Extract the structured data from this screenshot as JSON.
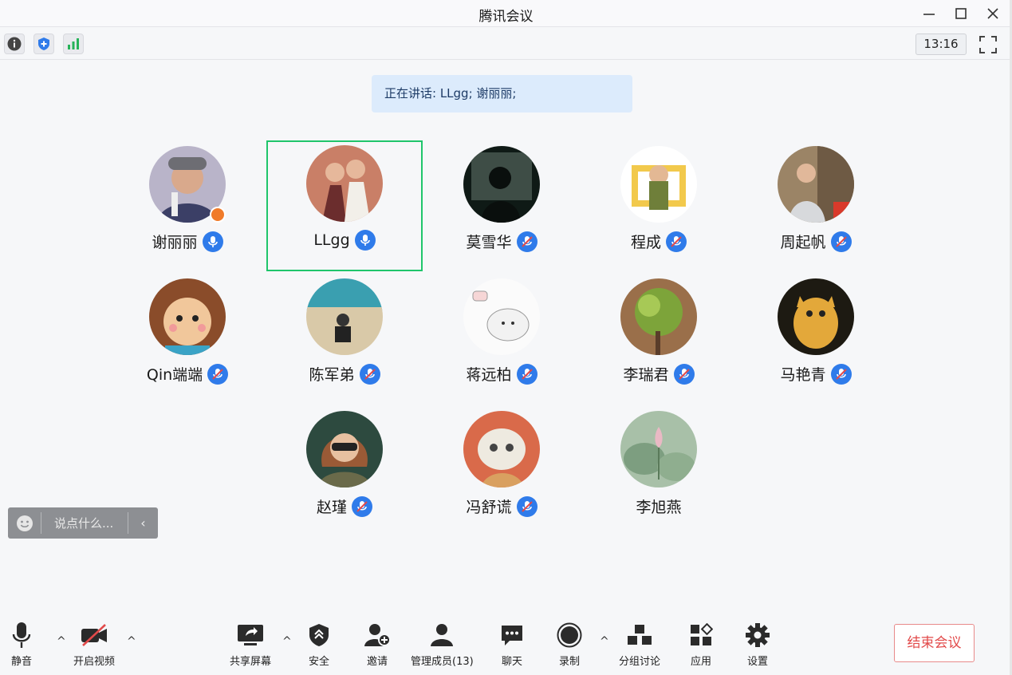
{
  "window": {
    "title": "腾讯会议"
  },
  "infobar": {
    "time": "13:16"
  },
  "speaking": {
    "text": "正在讲话: LLgg; 谢丽丽;"
  },
  "participants": [
    {
      "name": "谢丽丽",
      "mic": "on",
      "host": true,
      "active": false
    },
    {
      "name": "LLgg",
      "mic": "on",
      "host": false,
      "active": true
    },
    {
      "name": "莫雪华",
      "mic": "muted",
      "host": false,
      "active": false
    },
    {
      "name": "程成",
      "mic": "muted",
      "host": false,
      "active": false
    },
    {
      "name": "周起帆",
      "mic": "muted",
      "host": false,
      "active": false
    },
    {
      "name": "Qin端端",
      "mic": "muted",
      "host": false,
      "active": false
    },
    {
      "name": "陈军弟",
      "mic": "muted",
      "host": false,
      "active": false
    },
    {
      "name": "蒋远柏",
      "mic": "muted",
      "host": false,
      "active": false
    },
    {
      "name": "李瑞君",
      "mic": "muted",
      "host": false,
      "active": false
    },
    {
      "name": "马艳青",
      "mic": "muted",
      "host": false,
      "active": false
    },
    {
      "name": "赵瑾",
      "mic": "muted",
      "host": false,
      "active": false
    },
    {
      "name": "冯舒谎",
      "mic": "muted",
      "host": false,
      "active": false
    },
    {
      "name": "李旭燕",
      "mic": "none",
      "host": false,
      "active": false
    }
  ],
  "chat": {
    "placeholder": "说点什么..."
  },
  "toolbar": {
    "mute": "静音",
    "video": "开启视频",
    "share": "共享屏幕",
    "security": "安全",
    "invite": "邀请",
    "members": "管理成员(13)",
    "chat": "聊天",
    "record": "录制",
    "breakout": "分组讨论",
    "apps": "应用",
    "settings": "设置",
    "end": "结束会议"
  },
  "colors": {
    "accent": "#2f7bea",
    "active_border": "#1fc56b",
    "end": "#e24a4a",
    "banner": "#dcebfc"
  }
}
